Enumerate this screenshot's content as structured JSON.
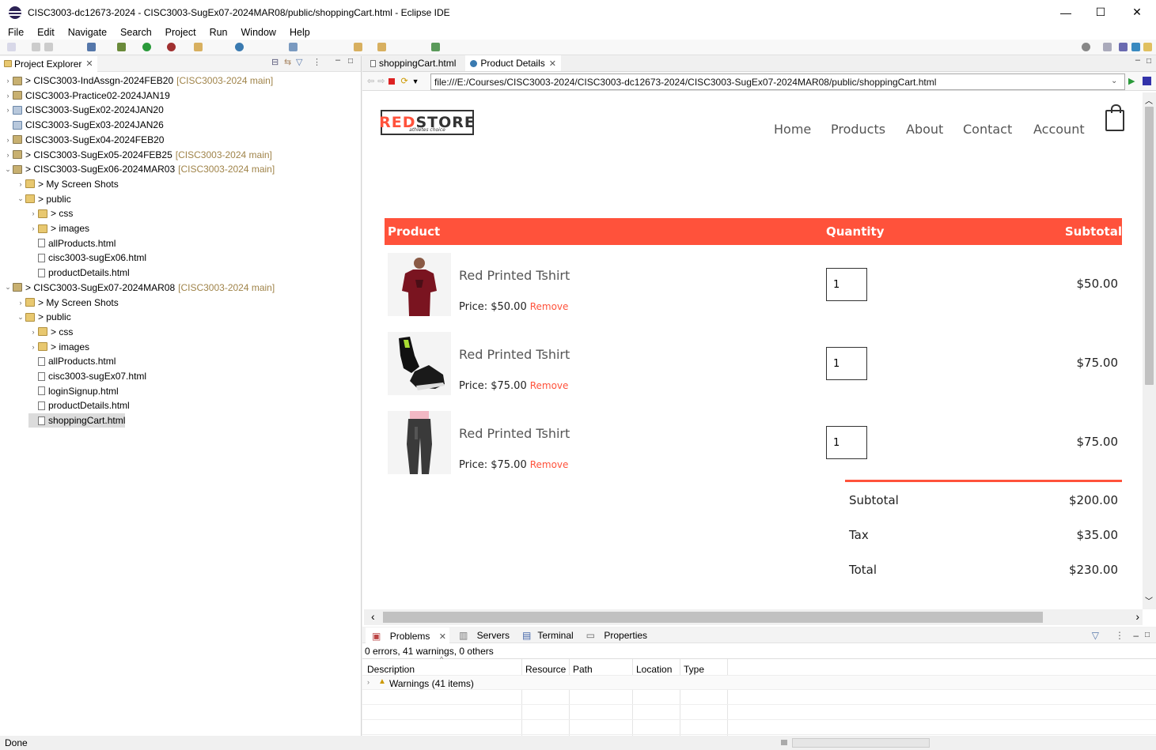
{
  "window": {
    "title": "CISC3003-dc12673-2024 - CISC3003-SugEx07-2024MAR08/public/shoppingCart.html - Eclipse IDE",
    "minimize": "—",
    "maximize": "☐",
    "close": "✕"
  },
  "menu": [
    "File",
    "Edit",
    "Navigate",
    "Search",
    "Project",
    "Run",
    "Window",
    "Help"
  ],
  "project_explorer": {
    "tab_label": "Project Explorer",
    "items": [
      {
        "label": "> CISC3003-IndAssgn-2024FEB20",
        "git": "[CISC3003-2024 main]",
        "indent": 0,
        "icon": "proj",
        "arrow": "›"
      },
      {
        "label": "CISC3003-Practice02-2024JAN19",
        "git": "",
        "indent": 0,
        "icon": "proj",
        "arrow": "›"
      },
      {
        "label": "CISC3003-SugEx02-2024JAN20",
        "git": "",
        "indent": 0,
        "icon": "proj2",
        "arrow": "›"
      },
      {
        "label": "CISC3003-SugEx03-2024JAN26",
        "git": "",
        "indent": 0,
        "icon": "proj2",
        "arrow": ""
      },
      {
        "label": "CISC3003-SugEx04-2024FEB20",
        "git": "",
        "indent": 0,
        "icon": "proj",
        "arrow": "›"
      },
      {
        "label": "> CISC3003-SugEx05-2024FEB25",
        "git": "[CISC3003-2024 main]",
        "indent": 0,
        "icon": "proj",
        "arrow": "›"
      },
      {
        "label": "> CISC3003-SugEx06-2024MAR03",
        "git": "[CISC3003-2024 main]",
        "indent": 0,
        "icon": "proj",
        "arrow": "⌄"
      },
      {
        "label": "> My Screen Shots",
        "git": "",
        "indent": 1,
        "icon": "fold",
        "arrow": "›"
      },
      {
        "label": "> public",
        "git": "",
        "indent": 1,
        "icon": "fold",
        "arrow": "⌄"
      },
      {
        "label": "> css",
        "git": "",
        "indent": 2,
        "icon": "fold",
        "arrow": "›"
      },
      {
        "label": "> images",
        "git": "",
        "indent": 2,
        "icon": "fold",
        "arrow": "›"
      },
      {
        "label": "allProducts.html",
        "git": "",
        "indent": 2,
        "icon": "file",
        "arrow": ""
      },
      {
        "label": "cisc3003-sugEx06.html",
        "git": "",
        "indent": 2,
        "icon": "file",
        "arrow": ""
      },
      {
        "label": "productDetails.html",
        "git": "",
        "indent": 2,
        "icon": "file",
        "arrow": ""
      },
      {
        "label": "> CISC3003-SugEx07-2024MAR08",
        "git": "[CISC3003-2024 main]",
        "indent": 0,
        "icon": "proj",
        "arrow": "⌄"
      },
      {
        "label": "> My Screen Shots",
        "git": "",
        "indent": 1,
        "icon": "fold",
        "arrow": "›"
      },
      {
        "label": "> public",
        "git": "",
        "indent": 1,
        "icon": "fold",
        "arrow": "⌄"
      },
      {
        "label": "> css",
        "git": "",
        "indent": 2,
        "icon": "fold",
        "arrow": "›"
      },
      {
        "label": "> images",
        "git": "",
        "indent": 2,
        "icon": "fold",
        "arrow": "›"
      },
      {
        "label": "allProducts.html",
        "git": "",
        "indent": 2,
        "icon": "file",
        "arrow": ""
      },
      {
        "label": "cisc3003-sugEx07.html",
        "git": "",
        "indent": 2,
        "icon": "file",
        "arrow": ""
      },
      {
        "label": "loginSignup.html",
        "git": "",
        "indent": 2,
        "icon": "file",
        "arrow": ""
      },
      {
        "label": "productDetails.html",
        "git": "",
        "indent": 2,
        "icon": "file",
        "arrow": ""
      },
      {
        "label": "shoppingCart.html",
        "git": "",
        "indent": 2,
        "icon": "file",
        "arrow": "",
        "selected": true
      }
    ]
  },
  "editor": {
    "tabs": [
      {
        "label": "shoppingCart.html",
        "active": false
      },
      {
        "label": "Product Details",
        "active": true
      }
    ],
    "url": "file:///E:/Courses/CISC3003-2024/CISC3003-dc12673-2024/CISC3003-SugEx07-2024MAR08/public/shoppingCart.html"
  },
  "site": {
    "logo_red": "RED",
    "logo_dark": "STORE",
    "logo_tagline": "athletes choice",
    "nav": [
      "Home",
      "Products",
      "About",
      "Contact",
      "Account"
    ],
    "table_headers": {
      "product": "Product",
      "quantity": "Quantity",
      "subtotal": "Subtotal"
    },
    "items": [
      {
        "name": "Red Printed Tshirt",
        "price": "Price: $50.00",
        "remove": "Remove",
        "qty": "1",
        "subtotal": "$50.00"
      },
      {
        "name": "Red Printed Tshirt",
        "price": "Price: $75.00",
        "remove": "Remove",
        "qty": "1",
        "subtotal": "$75.00"
      },
      {
        "name": "Red Printed Tshirt",
        "price": "Price: $75.00",
        "remove": "Remove",
        "qty": "1",
        "subtotal": "$75.00"
      }
    ],
    "totals": [
      {
        "label": "Subtotal",
        "value": "$200.00"
      },
      {
        "label": "Tax",
        "value": "$35.00"
      },
      {
        "label": "Total",
        "value": "$230.00"
      }
    ],
    "accent": "#ff523b"
  },
  "bottom": {
    "tabs": [
      "Problems",
      "Servers",
      "Terminal",
      "Properties"
    ],
    "summary": "0 errors, 41 warnings, 0 others",
    "columns": [
      "Description",
      "Resource",
      "Path",
      "Location",
      "Type"
    ],
    "row": "Warnings (41 items)"
  },
  "status": "Done"
}
